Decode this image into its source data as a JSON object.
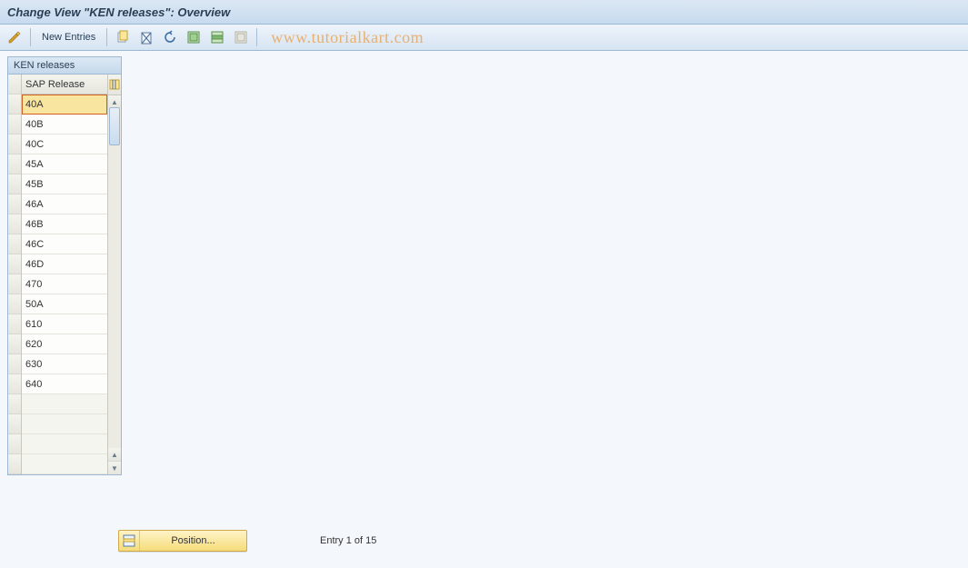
{
  "title": "Change View \"KEN releases\": Overview",
  "toolbar": {
    "new_entries_label": "New Entries",
    "watermark": "www.tutorialkart.com"
  },
  "panel": {
    "title": "KEN releases",
    "column_header": "SAP Release",
    "rows": [
      "40A",
      "40B",
      "40C",
      "45A",
      "45B",
      "46A",
      "46B",
      "46C",
      "46D",
      "470",
      "50A",
      "610",
      "620",
      "630",
      "640"
    ],
    "selected_index": 0,
    "empty_trailing_rows": 4
  },
  "footer": {
    "position_label": "Position...",
    "entry_text": "Entry 1 of 15"
  }
}
